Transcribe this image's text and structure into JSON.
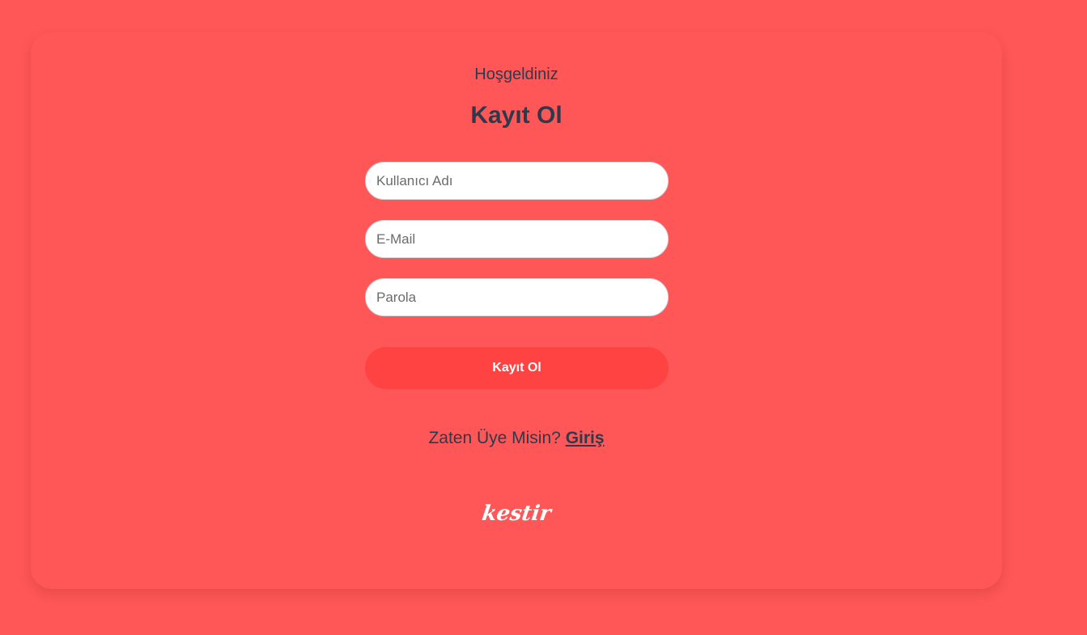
{
  "card": {
    "welcome": "Hoşgeldiniz",
    "title": "Kayıt Ol"
  },
  "form": {
    "username_placeholder": "Kullanıcı Adı",
    "email_placeholder": "E-Mail",
    "password_placeholder": "Parola",
    "submit_label": "Kayıt Ol"
  },
  "footer": {
    "question": "Zaten Üye Misin?",
    "login_link": "Giriş",
    "logo_text": "kestir"
  },
  "colors": {
    "background": "#ff5757",
    "button": "#ff4242",
    "text": "#2e3a4b",
    "input_bg": "#ffffff"
  }
}
